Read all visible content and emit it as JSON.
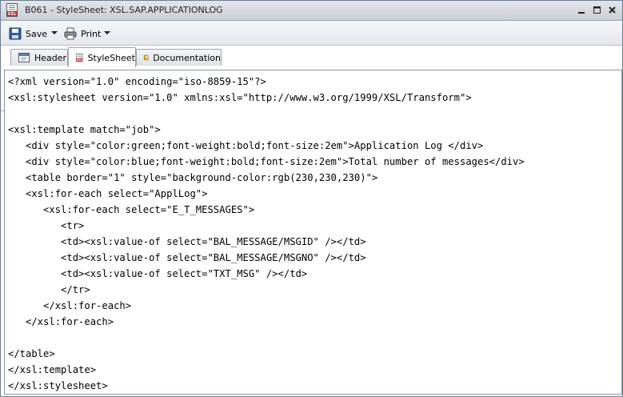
{
  "window": {
    "title": "B061 - StyleSheet: XSL.SAP.APPLICATIONLOG",
    "icon": "xsl-document-icon"
  },
  "toolbar": {
    "save_label": "Save",
    "print_label": "Print"
  },
  "tabs": [
    {
      "label": "Header",
      "icon": "header-icon",
      "active": false
    },
    {
      "label": "StyleSheet",
      "icon": "xsl-icon",
      "active": true
    },
    {
      "label": "Documentation",
      "icon": "book-icon",
      "active": false
    }
  ],
  "editor": {
    "lines": [
      "<?xml version=\"1.0\" encoding=\"iso-8859-15\"?>",
      "<xsl:stylesheet version=\"1.0\" xmlns:xsl=\"http://www.w3.org/1999/XSL/Transform\">",
      "",
      "<xsl:template match=\"job\">",
      "   <div style=\"color:green;font-weight:bold;font-size:2em\">Application Log </div>",
      "   <div style=\"color:blue;font-weight:bold;font-size:2em\">Total number of messages</div>",
      "   <table border=\"1\" style=\"background-color:rgb(230,230,230)\">",
      "   <xsl:for-each select=\"ApplLog\">",
      "      <xsl:for-each select=\"E_T_MESSAGES\">",
      "         <tr>",
      "         <td><xsl:value-of select=\"BAL_MESSAGE/MSGID\" /></td>",
      "         <td><xsl:value-of select=\"BAL_MESSAGE/MSGNO\" /></td>",
      "         <td><xsl:value-of select=\"TXT_MSG\" /></td>",
      "         </tr>",
      "      </xsl:for-each>",
      "   </xsl:for-each>",
      "",
      "</table>",
      "</xsl:template>",
      "</xsl:stylesheet>"
    ]
  }
}
